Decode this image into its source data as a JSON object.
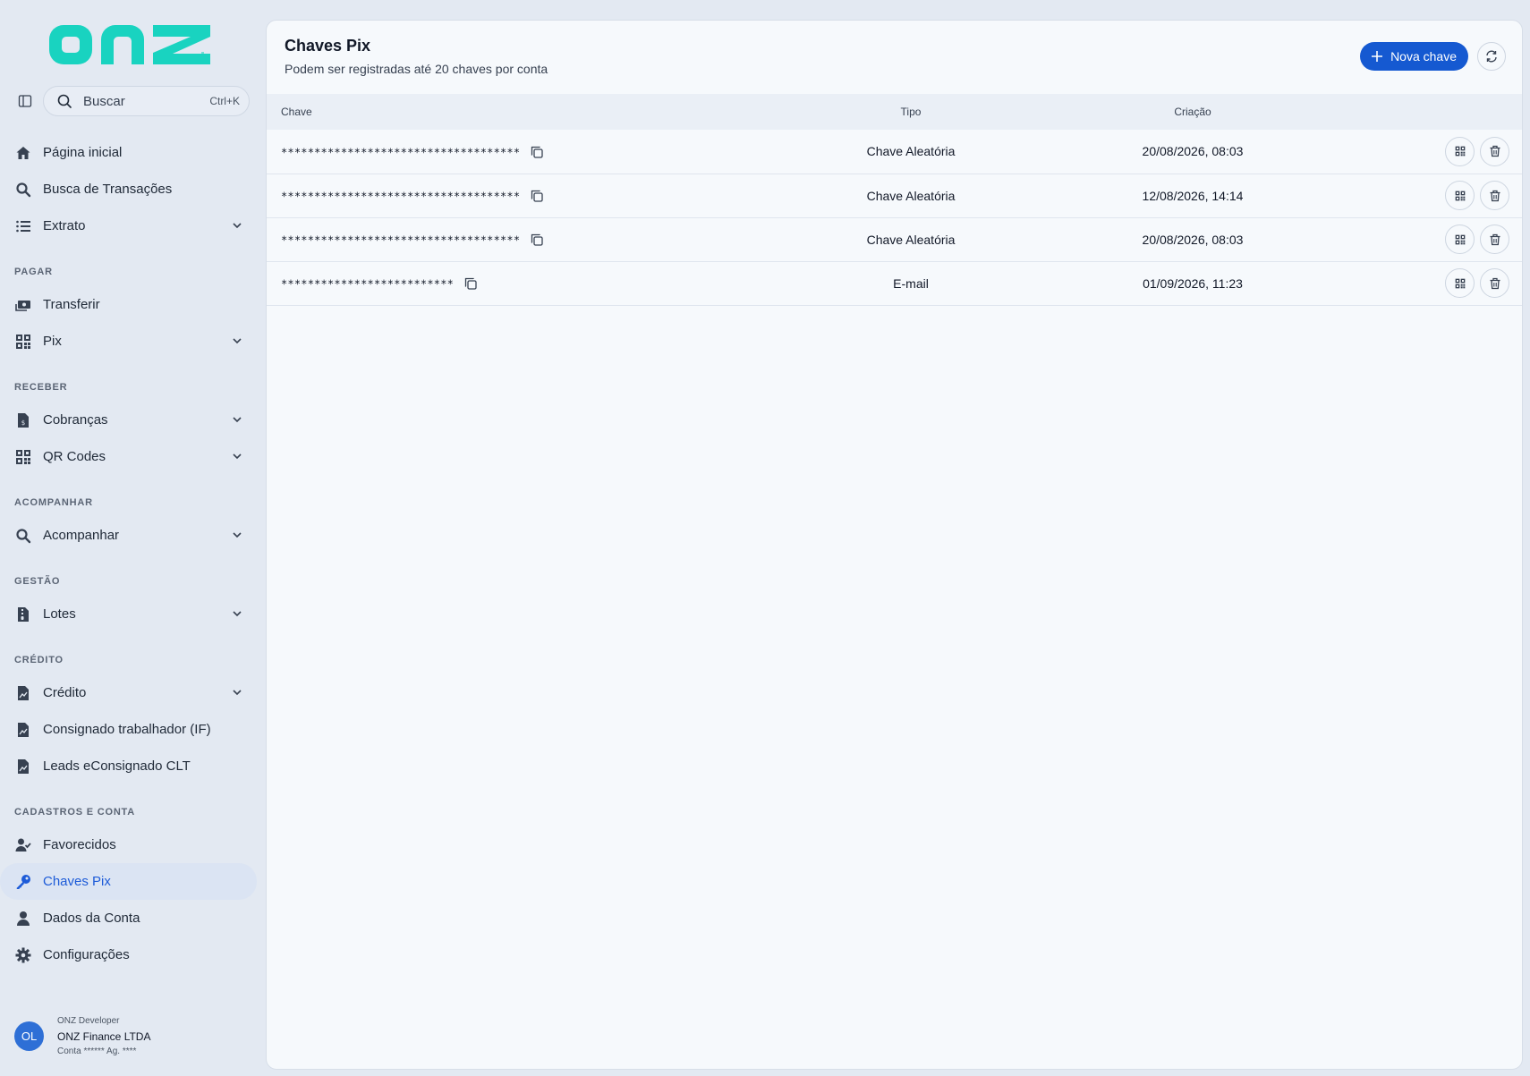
{
  "brand": {
    "logo_text": "onz",
    "accent": "#19d3c0",
    "primary": "#1559d1"
  },
  "search": {
    "placeholder": "Buscar",
    "shortcut": "Ctrl+K"
  },
  "nav": {
    "top": [
      {
        "label": "Página inicial",
        "icon": "home-icon"
      },
      {
        "label": "Busca de Transações",
        "icon": "search-icon"
      },
      {
        "label": "Extrato",
        "icon": "list-icon",
        "expandable": true
      }
    ],
    "sections": [
      {
        "title": "PAGAR",
        "items": [
          {
            "label": "Transferir",
            "icon": "money-transfer-icon"
          },
          {
            "label": "Pix",
            "icon": "qr-grid-icon",
            "expandable": true
          }
        ]
      },
      {
        "title": "RECEBER",
        "items": [
          {
            "label": "Cobranças",
            "icon": "invoice-icon",
            "expandable": true
          },
          {
            "label": "QR Codes",
            "icon": "qr-grid-icon",
            "expandable": true
          }
        ]
      },
      {
        "title": "ACOMPANHAR",
        "items": [
          {
            "label": "Acompanhar",
            "icon": "search-icon",
            "expandable": true
          }
        ]
      },
      {
        "title": "GESTÃO",
        "items": [
          {
            "label": "Lotes",
            "icon": "file-zip-icon",
            "expandable": true
          }
        ]
      },
      {
        "title": "CRÉDITO",
        "items": [
          {
            "label": "Crédito",
            "icon": "file-chart-icon",
            "expandable": true
          },
          {
            "label": "Consignado trabalhador (IF)",
            "icon": "file-chart-icon"
          },
          {
            "label": "Leads eConsignado CLT",
            "icon": "file-chart-icon"
          }
        ]
      },
      {
        "title": "CADASTROS E CONTA",
        "items": [
          {
            "label": "Favorecidos",
            "icon": "user-check-icon"
          },
          {
            "label": "Chaves Pix",
            "icon": "key-icon",
            "active": true
          },
          {
            "label": "Dados da Conta",
            "icon": "user-icon"
          },
          {
            "label": "Configurações",
            "icon": "gear-icon"
          }
        ]
      }
    ]
  },
  "user": {
    "initials": "OL",
    "role": "ONZ Developer",
    "company": "ONZ Finance LTDA",
    "account": "Conta ****** Ag. ****"
  },
  "page": {
    "title": "Chaves Pix",
    "subtitle": "Podem ser registradas até 20 chaves por conta",
    "new_button": "Nova chave"
  },
  "table": {
    "columns": {
      "key": "Chave",
      "type": "Tipo",
      "created": "Criação"
    },
    "rows": [
      {
        "key": "************************************",
        "type": "Chave Aleatória",
        "created": "20/08/2026, 08:03"
      },
      {
        "key": "************************************",
        "type": "Chave Aleatória",
        "created": "12/08/2026, 14:14"
      },
      {
        "key": "************************************",
        "type": "Chave Aleatória",
        "created": "20/08/2026, 08:03"
      },
      {
        "key": "**************************",
        "type": "E-mail",
        "created": "01/09/2026, 11:23"
      }
    ]
  }
}
